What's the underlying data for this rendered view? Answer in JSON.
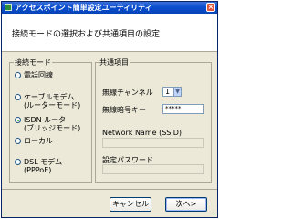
{
  "window": {
    "title": "アクセスポイント簡単設定ユーティリティ",
    "close_label": "×"
  },
  "header": {
    "title": "接続モードの選択および共通項目の設定"
  },
  "connection_mode": {
    "label": "接続モード",
    "options": [
      {
        "line1": "電話回線",
        "line2": "",
        "checked": false
      },
      {
        "line1": "ケーブルモデム",
        "line2": "(ルーターモード)",
        "checked": false
      },
      {
        "line1": "ISDN ルータ",
        "line2": "(ブリッジモード)",
        "checked": true
      },
      {
        "line1": "ローカル",
        "line2": "",
        "checked": false
      },
      {
        "line1": "DSL モデム",
        "line2": "(PPPoE)",
        "checked": false
      }
    ]
  },
  "common": {
    "label": "共通項目",
    "channel_label": "無線チャンネル",
    "channel_value": "1",
    "key_label": "無線暗号キー",
    "key_value": "*****",
    "network_name_label": "Network Name (SSID)",
    "network_name_value": "",
    "password_label": "設定パスワード",
    "password_value": ""
  },
  "footer": {
    "cancel_label": "キャンセル",
    "next_label": "次へ>"
  },
  "colors": {
    "titlebar": "#0a4fd0",
    "face": "#ece9d8",
    "radio_checked": "#21a121"
  }
}
